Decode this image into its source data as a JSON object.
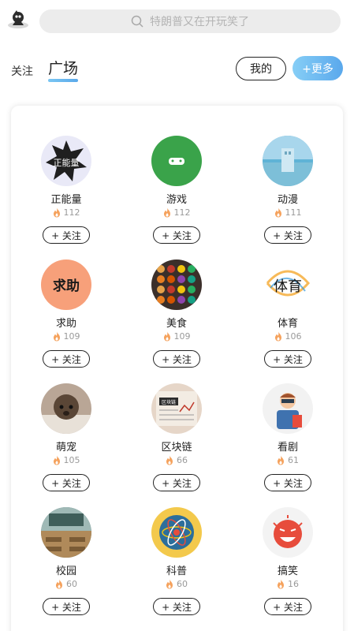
{
  "search": {
    "placeholder": "特朗普又在开玩笑了"
  },
  "tabs": {
    "follow": "关注",
    "square": "广场"
  },
  "buttons": {
    "mine": "我的",
    "more": "+更多"
  },
  "follow_label": "+ 关注",
  "topics": [
    {
      "name": "正能量",
      "heat": "112",
      "icon": "positive-energy-icon",
      "color": "#e9e9f7"
    },
    {
      "name": "游戏",
      "heat": "112",
      "icon": "game-controller-icon",
      "color": "#3aa34a"
    },
    {
      "name": "动漫",
      "heat": "111",
      "icon": "anime-scene-icon",
      "color": "#5fb3d6"
    },
    {
      "name": "求助",
      "heat": "109",
      "icon": "help-text-icon",
      "color": "#f7a07a"
    },
    {
      "name": "美食",
      "heat": "109",
      "icon": "food-platter-icon",
      "color": "#3b2f2a"
    },
    {
      "name": "体育",
      "heat": "106",
      "icon": "sports-calligraphy-icon",
      "color": "#ffffff"
    },
    {
      "name": "萌宠",
      "heat": "105",
      "icon": "pet-poodle-icon",
      "color": "#b9a696"
    },
    {
      "name": "区块链",
      "heat": "66",
      "icon": "blockchain-newspaper-icon",
      "color": "#e6d6c8"
    },
    {
      "name": "看剧",
      "heat": "61",
      "icon": "drama-viewer-icon",
      "color": "#f2f2f2"
    },
    {
      "name": "校园",
      "heat": "60",
      "icon": "campus-classroom-icon",
      "color": "#6d8b88"
    },
    {
      "name": "科普",
      "heat": "60",
      "icon": "science-atom-icon",
      "color": "#f3c94c"
    },
    {
      "name": "搞笑",
      "heat": "16",
      "icon": "funny-face-icon",
      "color": "#f3f3f3"
    }
  ]
}
